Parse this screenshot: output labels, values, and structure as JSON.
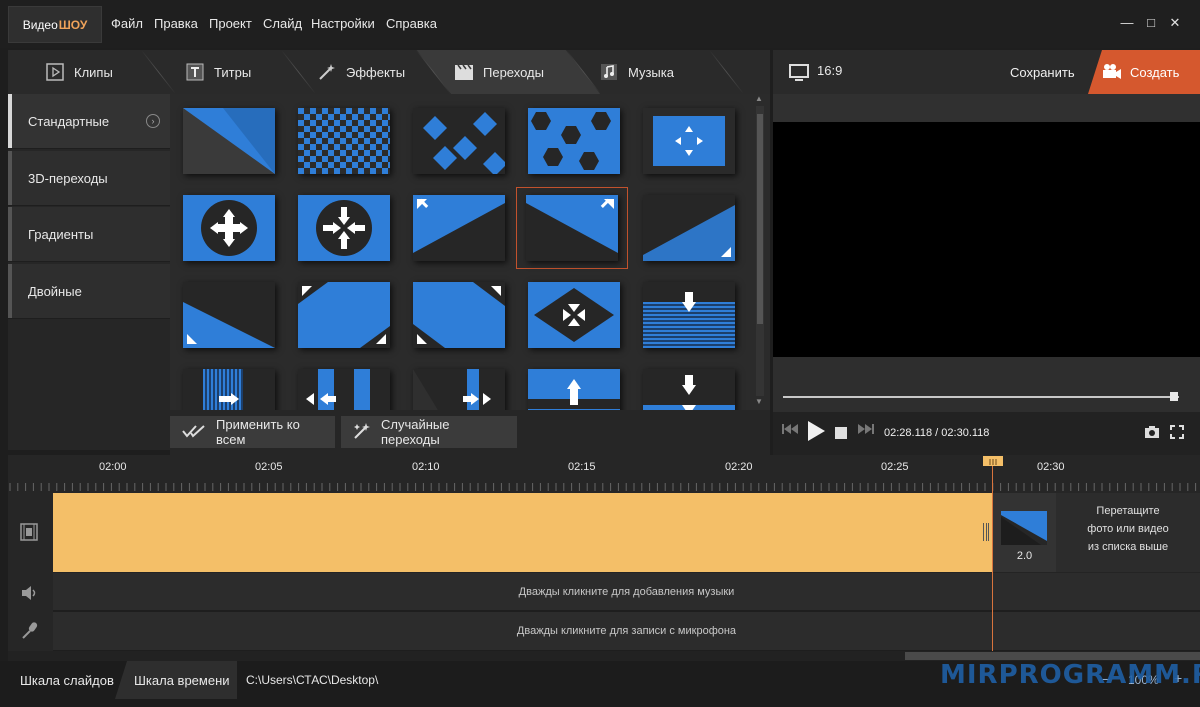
{
  "app": {
    "logo_part1": "Видео",
    "logo_part2": "ШОУ"
  },
  "menu": [
    "Файл",
    "Правка",
    "Проект",
    "Слайд",
    "Настройки",
    "Справка"
  ],
  "window_controls": [
    "—",
    "□",
    "✕"
  ],
  "tabs": [
    {
      "label": "Клипы",
      "icon": "play-icon"
    },
    {
      "label": "Титры",
      "icon": "text-icon"
    },
    {
      "label": "Эффекты",
      "icon": "magic-wand-icon"
    },
    {
      "label": "Переходы",
      "icon": "clapperboard-icon",
      "active": true
    },
    {
      "label": "Музыка",
      "icon": "music-note-icon"
    }
  ],
  "categories": [
    {
      "label": "Стандартные",
      "active": true
    },
    {
      "label": "3D-переходы"
    },
    {
      "label": "Градиенты"
    },
    {
      "label": "Двойные"
    }
  ],
  "grid_buttons": {
    "apply_all": "Применить ко всем",
    "random": "Случайные переходы"
  },
  "preview": {
    "aspect_ratio": "16:9",
    "save_label": "Сохранить",
    "create_label": "Создать",
    "timecode": "02:28.118 / 02:30.118",
    "progress_fraction": 0.987
  },
  "timeline": {
    "ruler_labels": [
      "02:00",
      "02:05",
      "02:10",
      "02:15",
      "02:20",
      "02:25",
      "02:30"
    ],
    "transition_duration": "2.0",
    "drop_hint": [
      "Перетащите",
      "фото или видео",
      "из списка выше"
    ],
    "music_hint": "Дважды кликните для добавления музыки",
    "mic_hint": "Дважды кликните для записи с микрофона"
  },
  "bottom": {
    "tab_slides": "Шкала слайдов",
    "tab_timeline": "Шкала времени",
    "path": "C:\\Users\\СТАС\\Desktop\\",
    "zoom": "100%",
    "watermark": "MIRPROGRAMM.RU"
  },
  "colors": {
    "accent": "#d5582e",
    "clip": "#f4bf68",
    "thumb_blue": "#2f7ed8"
  }
}
